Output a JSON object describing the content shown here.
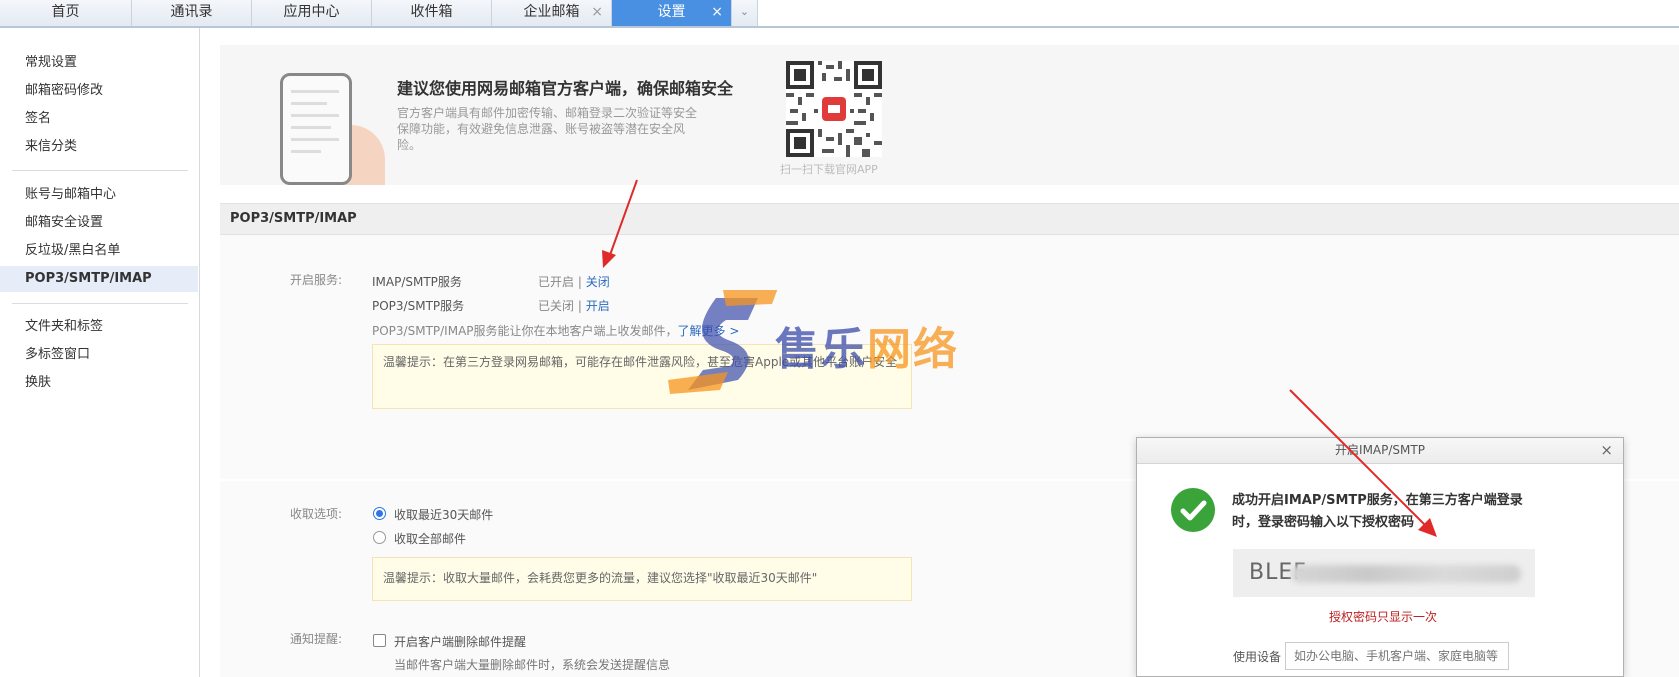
{
  "tabs": [
    {
      "label": "首页"
    },
    {
      "label": "通讯录"
    },
    {
      "label": "应用中心"
    },
    {
      "label": "收件箱"
    },
    {
      "label": "企业邮箱",
      "close": "×"
    },
    {
      "label": "设置",
      "close": "×"
    }
  ],
  "tab_more": "⌄",
  "sidebar": {
    "items": [
      {
        "label": "常规设置"
      },
      {
        "label": "邮箱密码修改"
      },
      {
        "label": "签名"
      },
      {
        "label": "来信分类"
      },
      {
        "label": "账号与邮箱中心"
      },
      {
        "label": "邮箱安全设置"
      },
      {
        "label": "反垃圾/黑白名单"
      },
      {
        "label": "POP3/SMTP/IMAP"
      },
      {
        "label": "文件夹和标签"
      },
      {
        "label": "多标签窗口"
      },
      {
        "label": "换肤"
      }
    ],
    "active": "POP3/SMTP/IMAP"
  },
  "promo": {
    "title": "建议您使用网易邮箱官方客户端，确保邮箱安全",
    "desc": "官方客户端具有邮件加密传输、邮箱登录二次验证等安全保障功能，有效避免信息泄露、账号被盗等潜在安全风险。",
    "qr_caption": "扫一扫下载官网APP"
  },
  "section_title": "POP3/SMTP/IMAP",
  "service": {
    "label": "开启服务:",
    "rows": [
      {
        "name": "IMAP/SMTP服务",
        "status": "已开启",
        "sep": "|",
        "action": "关闭"
      },
      {
        "name": "POP3/SMTP服务",
        "status": "已关闭",
        "sep": "|",
        "action": "开启"
      }
    ],
    "desc": "POP3/SMTP/IMAP服务能让你在本地客户端上收发邮件，",
    "learn_more": "了解更多 >",
    "tip": "温馨提示：在第三方登录网易邮箱，可能存在邮件泄露风险，甚至危害Apple或其他平台账户安全"
  },
  "receive": {
    "label": "收取选项:",
    "options": [
      {
        "label": "收取最近30天邮件",
        "checked": true
      },
      {
        "label": "收取全部邮件",
        "checked": false
      }
    ],
    "tip": "温馨提示：收取大量邮件，会耗费您更多的流量，建议您选择\"收取最近30天邮件\""
  },
  "notify": {
    "label": "通知提醒:",
    "option": "开启客户端删除邮件提醒",
    "desc": "当邮件客户端大量删除邮件时，系统会发送提醒信息"
  },
  "watermark": {
    "text_a": "售乐",
    "text_b": "网络"
  },
  "dialog": {
    "title": "开启IMAP/SMTP",
    "close": "×",
    "message": "成功开启IMAP/SMTP服务，在第三方客户端登录时，登录密码输入以下授权密码",
    "code_visible": "BLEF",
    "warning": "授权密码只显示一次",
    "device_label": "使用设备",
    "device_placeholder": "如办公电脑、手机客户端、家庭电脑等"
  },
  "colors": {
    "accent": "#4a90e2",
    "link": "#2a6bbf",
    "success": "#3aa33a",
    "warning": "#bb2222",
    "arrow": "#e02a2a"
  }
}
